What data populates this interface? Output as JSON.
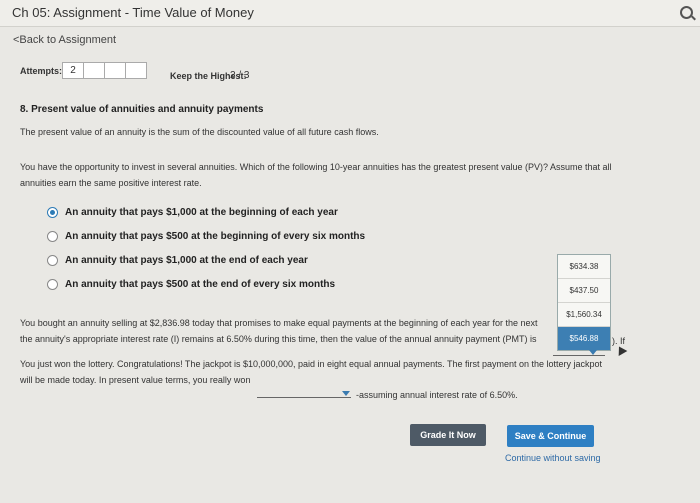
{
  "header": {
    "title": "Ch 05: Assignment - Time Value of Money",
    "icon": "search-icon"
  },
  "nav": {
    "back": "<Back to Assignment"
  },
  "attempts": {
    "label": "Attempts:",
    "boxes": [
      "2",
      "",
      "",
      ""
    ],
    "keep_label": "Keep the Highest:",
    "keep_value": "2 / 3"
  },
  "question": {
    "title": "8. Present value of annuities and annuity payments",
    "intro": "The present value of an annuity is the sum of the discounted value of all future cash flows.",
    "prompt_line1": "You have the opportunity to invest in several annuities. Which of the following 10-year annuities has the greatest present value (PV)? Assume that all",
    "prompt_line2": "annuities earn the same positive interest rate.",
    "options": [
      {
        "label": "An annuity that pays $1,000 at the beginning of each year",
        "selected": true
      },
      {
        "label": "An annuity that pays $500 at the beginning of every six months",
        "selected": false
      },
      {
        "label": "An annuity that pays $1,000 at the end of each year",
        "selected": false
      },
      {
        "label": "An annuity that pays $500 at the end of every six months",
        "selected": false
      }
    ]
  },
  "annuity_payment": {
    "line1": "You bought an annuity selling at $2,836.98 today that promises to make equal payments at the beginning of each year for the next",
    "line2": "the annuity's appropriate interest rate (I) remains at 6.50% during this time, then the value of the annual annuity payment (PMT) is",
    "tail": "). If",
    "dropdown_options": [
      "$634.38",
      "$437.50",
      "$1,560.34",
      "$546.88"
    ],
    "highlighted_option": "$634.38"
  },
  "lottery": {
    "line1": "You just won the lottery. Congratulations! The jackpot is $10,000,000, paid in eight equal annual payments. The first payment on the lottery jackpot",
    "line2": "will be made today. In present value terms, you really won",
    "line3": "-assuming annual interest rate of 6.50%."
  },
  "actions": {
    "grade": "Grade It Now",
    "save": "Save & Continue",
    "continue": "Continue without saving"
  },
  "colors": {
    "accent": "#2e7fc3",
    "grade_button": "#4e5a66",
    "background": "#e9e8e4"
  }
}
